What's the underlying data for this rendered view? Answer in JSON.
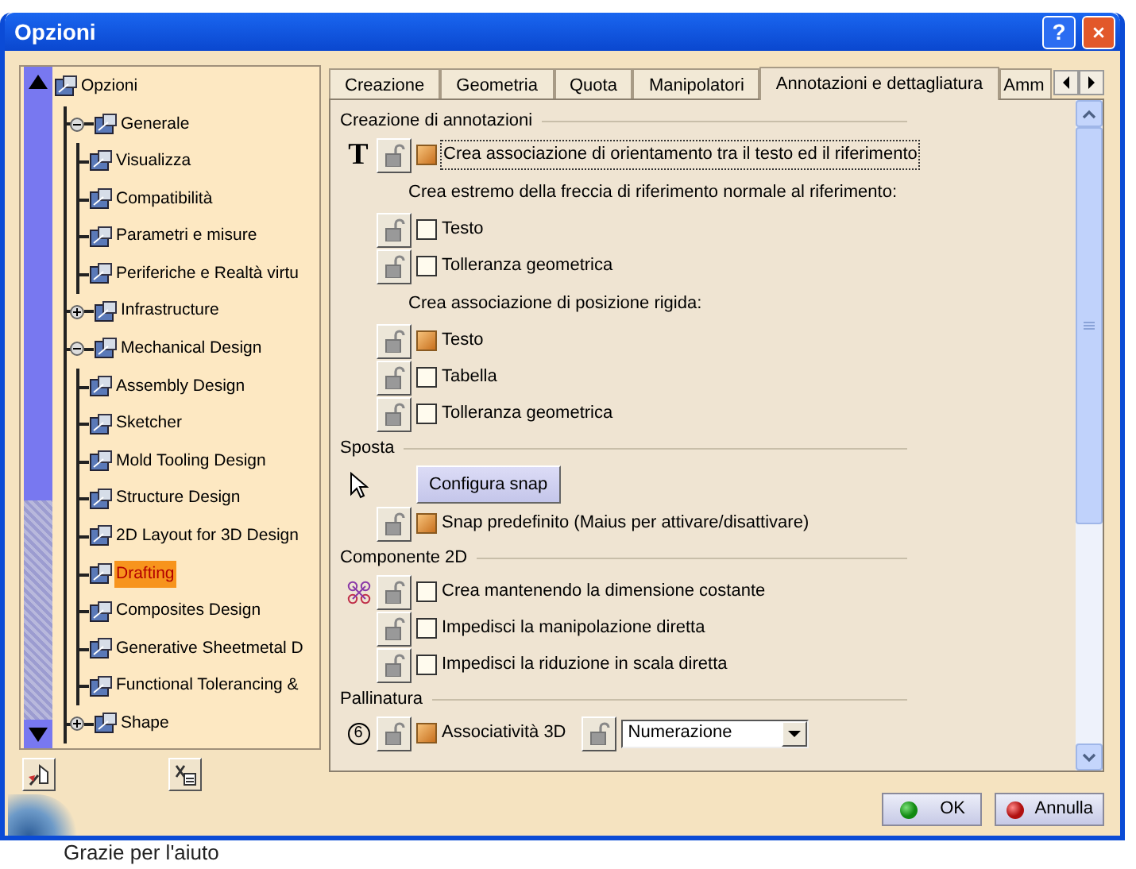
{
  "window": {
    "title": "Opzioni",
    "help_label": "?"
  },
  "tree": [
    {
      "label": "Opzioni",
      "selected": false,
      "children": [
        {
          "label": "Generale",
          "expanded": true,
          "selected": false,
          "children": [
            {
              "label": "Visualizza",
              "selected": false
            },
            {
              "label": "Compatibilità",
              "selected": false
            },
            {
              "label": "Parametri e misure",
              "selected": false
            },
            {
              "label": "Periferiche e Realtà virtu",
              "selected": false
            }
          ]
        },
        {
          "label": "Infrastructure",
          "expanded": false,
          "selected": false
        },
        {
          "label": "Mechanical Design",
          "expanded": true,
          "selected": false,
          "children": [
            {
              "label": "Assembly Design",
              "selected": false
            },
            {
              "label": "Sketcher",
              "selected": false
            },
            {
              "label": "Mold Tooling Design",
              "selected": false
            },
            {
              "label": "Structure Design",
              "selected": false
            },
            {
              "label": "2D Layout for 3D Design",
              "selected": false
            },
            {
              "label": "Drafting",
              "selected": true
            },
            {
              "label": "Composites Design",
              "selected": false
            },
            {
              "label": "Generative Sheetmetal D",
              "selected": false
            },
            {
              "label": "Functional Tolerancing &",
              "selected": false
            }
          ]
        },
        {
          "label": "Shape",
          "expanded": false,
          "selected": false
        }
      ]
    }
  ],
  "tabs": [
    {
      "label": "Creazione",
      "selected": false
    },
    {
      "label": "Geometria",
      "selected": false
    },
    {
      "label": "Quota",
      "selected": false
    },
    {
      "label": "Manipolatori",
      "selected": false
    },
    {
      "label": "Annotazioni e dettagliatura",
      "selected": true
    },
    {
      "label": "Amm",
      "selected": false
    }
  ],
  "sections": [
    {
      "title": "Creazione di annotazioni",
      "rows": [
        {
          "kind": "option",
          "glyph": "T",
          "label": "Crea associazione di orientamento tra il testo ed il riferimento",
          "checked": true,
          "focused": true
        },
        {
          "kind": "label",
          "label": "Crea estremo della freccia di riferimento normale al riferimento:",
          "children": [
            {
              "kind": "option",
              "label": "Testo",
              "checked": false
            },
            {
              "kind": "option",
              "label": "Tolleranza geometrica",
              "checked": false
            }
          ]
        },
        {
          "kind": "label",
          "label": "Crea associazione di posizione rigida:",
          "children": [
            {
              "kind": "option",
              "label": "Testo",
              "checked": true
            },
            {
              "kind": "option",
              "label": "Tabella",
              "checked": false
            },
            {
              "kind": "option",
              "label": "Tolleranza geometrica",
              "checked": false
            }
          ]
        }
      ]
    },
    {
      "title": "Sposta",
      "rows": [
        {
          "kind": "button",
          "lead": {
            "kind": "pointer"
          },
          "label": "Configura snap"
        },
        {
          "kind": "option",
          "label": "Snap predefinito (Maius per attivare/disattivare)",
          "checked": true
        }
      ]
    },
    {
      "title": "Componente 2D",
      "rows": [
        {
          "kind": "option",
          "lead": {
            "kind": "nodes"
          },
          "label": "Crea mantenendo la dimensione costante",
          "checked": false
        },
        {
          "kind": "option",
          "label": "Impedisci la manipolazione diretta",
          "checked": false
        },
        {
          "kind": "option",
          "label": "Impedisci la riduzione in scala diretta",
          "checked": false
        }
      ]
    },
    {
      "title": "Pallinatura",
      "rows": [
        {
          "kind": "option",
          "lead": {
            "kind": "balloon",
            "glyph": "6"
          },
          "label": "Associatività 3D",
          "checked": true,
          "dropdown": {
            "value": "Numerazione"
          }
        }
      ]
    }
  ],
  "buttons": [
    {
      "kind": "ok",
      "label": "OK"
    },
    {
      "kind": "cancel",
      "label": "Annulla"
    }
  ],
  "background_text": "Grazie per l'aiuto"
}
